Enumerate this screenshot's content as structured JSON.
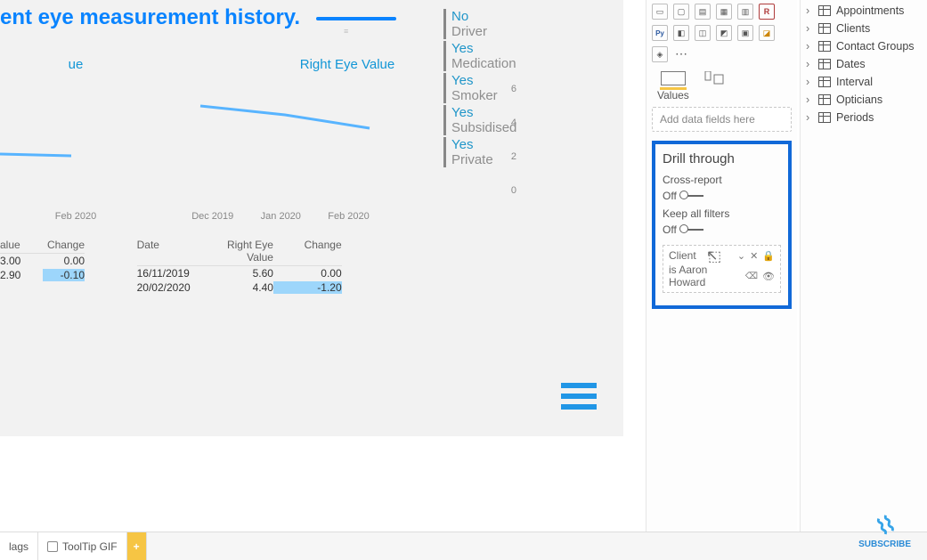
{
  "title": "ent eye measurement history.",
  "left_chart_title": "ue",
  "right_chart_title": "Right Eye Value",
  "chart_data": [
    {
      "type": "line",
      "title": "ue",
      "x": [
        "Feb 2020"
      ],
      "values": [
        2.9
      ],
      "ylim": [
        0,
        6
      ],
      "partial": true
    },
    {
      "type": "line",
      "title": "Right Eye Value",
      "x": [
        "Dec 2019",
        "Jan 2020",
        "Feb 2020"
      ],
      "values": [
        5.6,
        5.0,
        4.4
      ],
      "ylabel": "",
      "ylim": [
        0,
        6
      ],
      "yticks": [
        0,
        2,
        4,
        6
      ]
    }
  ],
  "left_x": [
    "Feb 2020"
  ],
  "right_x": [
    "Dec 2019",
    "Jan 2020",
    "Feb 2020"
  ],
  "right_yticks": [
    "6",
    "4",
    "2",
    "0"
  ],
  "slicers": [
    {
      "value": "No",
      "label": "Driver"
    },
    {
      "value": "Yes",
      "label": "Medication"
    },
    {
      "value": "Yes",
      "label": "Smoker"
    },
    {
      "value": "Yes",
      "label": "Subsidised"
    },
    {
      "value": "Yes",
      "label": "Private"
    }
  ],
  "left_table": {
    "headers": [
      "alue",
      "Change"
    ],
    "rows": [
      [
        "3.00",
        "0.00"
      ],
      [
        "2.90",
        "-0.10"
      ]
    ],
    "highlight": {
      "row": 1,
      "col": 1
    }
  },
  "right_table": {
    "headers": [
      "Date",
      "Right Eye   Value",
      "Change"
    ],
    "rows": [
      [
        "16/11/2019",
        "5.60",
        "0.00"
      ],
      [
        "20/02/2020",
        "4.40",
        "-1.20"
      ]
    ],
    "highlight": {
      "row": 1,
      "col": 2
    }
  },
  "tabs": {
    "first": "lags",
    "tooltip": "ToolTip GIF",
    "add": "+"
  },
  "viz": {
    "values_label": "Values",
    "well_placeholder": "Add data fields here"
  },
  "drill": {
    "title": "Drill through",
    "cross": "Cross-report",
    "off1": "Off",
    "keep": "Keep all filters",
    "off2": "Off",
    "field_name": "Client",
    "field_filter": "is Aaron Howard"
  },
  "fields": [
    "Appointments",
    "Clients",
    "Contact Groups",
    "Dates",
    "Interval",
    "Opticians",
    "Periods"
  ],
  "brand": "SUBSCRIBE"
}
